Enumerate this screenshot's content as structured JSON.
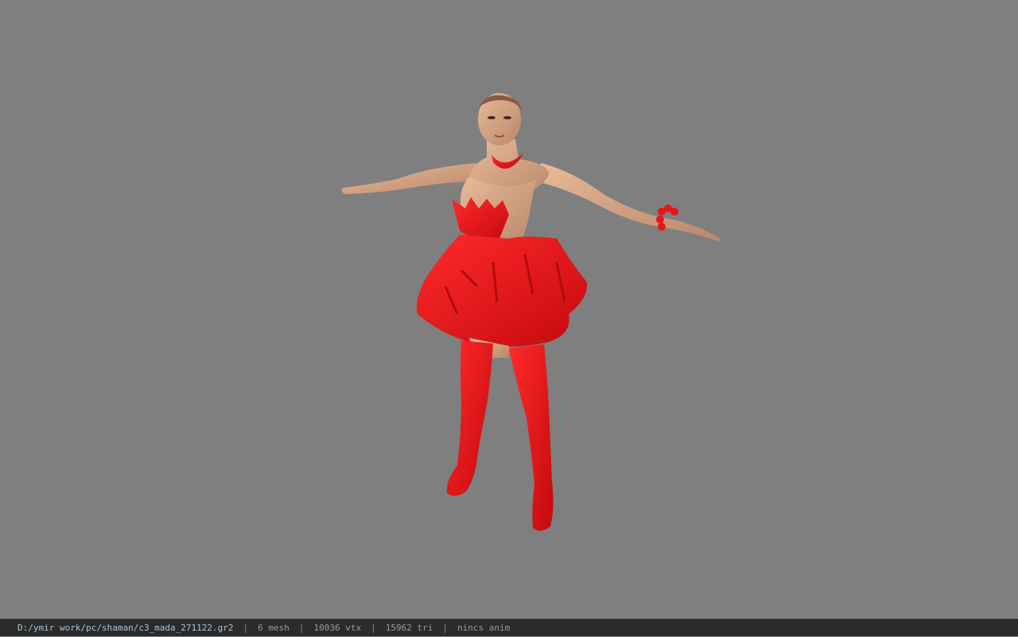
{
  "viewport": {
    "background_color": "#7f7f7f",
    "model_skin_color": "#d9a887",
    "model_outfit_color": "#e8141a"
  },
  "status_bar": {
    "file_path": "D:/ymir work/pc/shaman/c3_mada_271122.gr2",
    "separator": "|",
    "mesh_count": "6 mesh",
    "vertex_count": "10036 vtx",
    "triangle_count": "15962 tri",
    "anim_status": "nincs anim"
  }
}
